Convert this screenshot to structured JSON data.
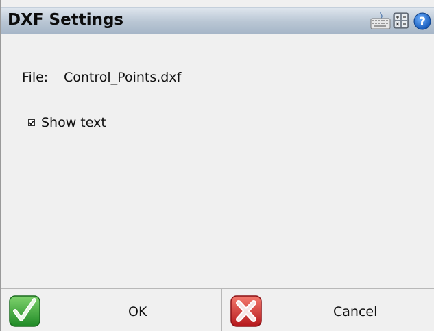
{
  "window": {
    "title": "DXF Settings"
  },
  "toolbar_icons": [
    "keyboard-icon",
    "calculator-icon",
    "help-icon"
  ],
  "file": {
    "label": "File:",
    "value": "Control_Points.dxf"
  },
  "options": {
    "show_text": {
      "label": "Show text",
      "checked": true
    }
  },
  "buttons": {
    "ok_label": "OK",
    "cancel_label": "Cancel"
  },
  "colors": {
    "titlebar": "#b9c6d4",
    "background": "#f0f0f0",
    "ok_green": "#3aa83a",
    "cancel_red": "#d9302a"
  }
}
